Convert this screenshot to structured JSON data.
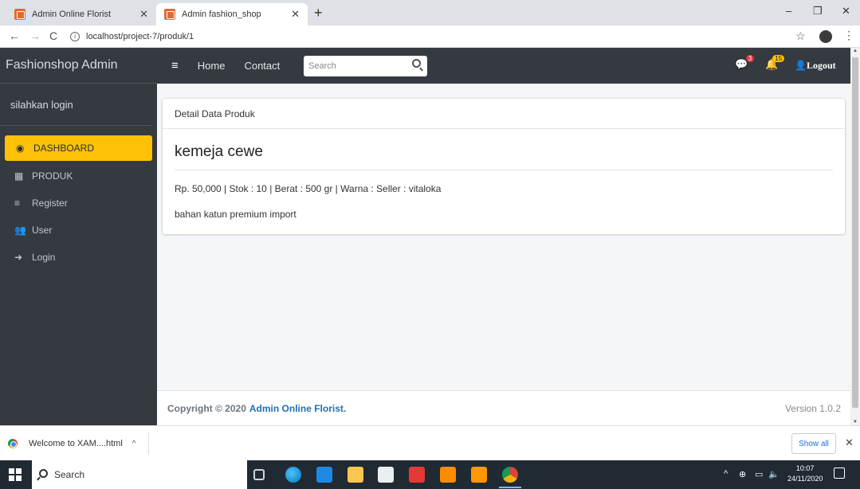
{
  "browser": {
    "tabs": [
      {
        "title": "Admin Online Florist",
        "close": "✕"
      },
      {
        "title": "Admin fashion_shop",
        "close": "✕"
      }
    ],
    "new_tab": "+",
    "window_controls": {
      "minimize": "–",
      "restore": "❐",
      "close": "✕"
    },
    "url": "localhost/project-7/produk/1",
    "icons": {
      "back": "←",
      "forward": "→",
      "reload": "C",
      "info": "i",
      "star": "☆",
      "menu": "⋮"
    }
  },
  "sidebar": {
    "brand": "Fashionshop Admin",
    "user_text": "silahkan login",
    "items": [
      {
        "label": "DASHBOARD",
        "icon": "dashboard-icon",
        "glyph": "◉"
      },
      {
        "label": "PRODUK",
        "icon": "product-icon",
        "glyph": "▦"
      },
      {
        "label": "Register",
        "icon": "list-icon",
        "glyph": "≡"
      },
      {
        "label": "User",
        "icon": "users-icon",
        "glyph": "👥"
      },
      {
        "label": "Login",
        "icon": "login-icon",
        "glyph": "➜"
      }
    ]
  },
  "topnav": {
    "menu_glyph": "≡",
    "links": [
      "Home",
      "Contact"
    ],
    "search_placeholder": "Search",
    "messages_badge": "3",
    "notifications_badge": "15",
    "logout": "Logout",
    "glyphs": {
      "messages": "💬",
      "notifications": "🔔",
      "user": "👤"
    }
  },
  "card": {
    "header": "Detail Data Produk",
    "product_name": "kemeja cewe",
    "meta": "Rp. 50,000 | Stok : 10 | Berat : 500 gr | Warna : Seller : vitaloka",
    "description": "bahan katun premium import"
  },
  "footer": {
    "copyright": "Copyright © 2020",
    "brand": "Admin Online Florist.",
    "version": "Version 1.0.2"
  },
  "downloads": {
    "file": "Welcome to XAM....html",
    "chevron": "^",
    "show_all": "Show all",
    "close": "✕"
  },
  "taskbar": {
    "search": "Search",
    "time": "10:07",
    "date": "24/11/2020",
    "tray_glyphs": {
      "chevron": "^",
      "network": "⊕",
      "battery": "▭",
      "volume": "🔈"
    },
    "apps": [
      "task-view",
      "edge",
      "mail",
      "file-explorer",
      "store",
      "gift",
      "xampp",
      "sublime",
      "chrome"
    ]
  },
  "colors": {
    "sidebar_bg": "#343a40",
    "active_item": "#ffc107",
    "content_bg": "#f4f6f9",
    "link_blue": "#1f6fb0",
    "badge_red": "#dc3545",
    "badge_yellow": "#ffc107",
    "taskbar_bg": "#1f2a33"
  }
}
